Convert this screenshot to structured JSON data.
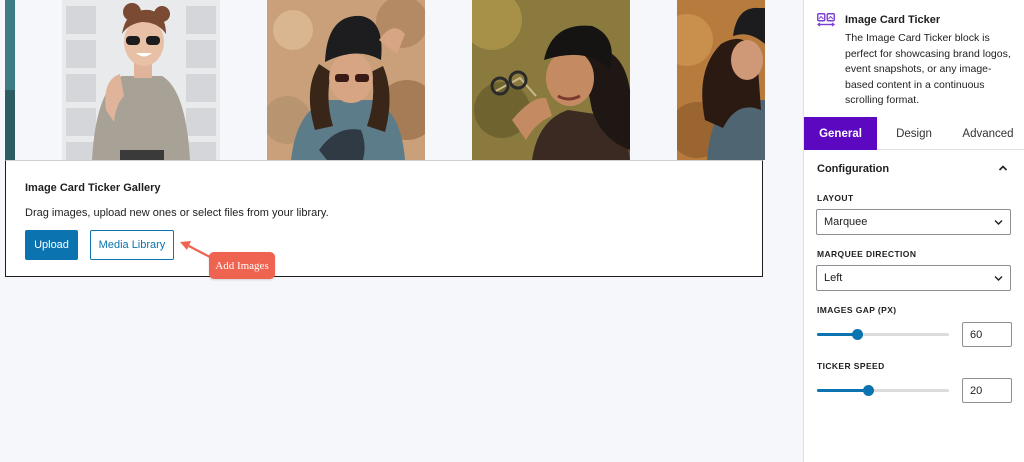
{
  "gallery": {
    "title": "Image Card Ticker Gallery",
    "instructions": "Drag images, upload new ones or select files from your library.",
    "upload_label": "Upload",
    "media_library_label": "Media Library",
    "ticker_images": [
      {
        "name": "smiling-woman-sunglasses"
      },
      {
        "name": "woman-beanie-sunglasses"
      },
      {
        "name": "woman-holding-sunglasses"
      },
      {
        "name": "woman-curly-hair-jacket"
      }
    ]
  },
  "annotation": {
    "callout_text": "Add Images"
  },
  "sidebar": {
    "block": {
      "icon": "image-card-ticker-icon",
      "title": "Image Card Ticker",
      "description": "The Image Card Ticker block is perfect for showcasing brand logos, event snapshots, or any image-based content in a continuous scrolling format."
    },
    "tabs": [
      {
        "label": "General",
        "active": true
      },
      {
        "label": "Design",
        "active": false
      },
      {
        "label": "Advanced",
        "active": false
      }
    ],
    "panel": {
      "title": "Configuration",
      "toggle_icon": "chevron-up-icon",
      "layout": {
        "label": "LAYOUT",
        "value": "Marquee"
      },
      "marquee_direction": {
        "label": "MARQUEE DIRECTION",
        "value": "Left"
      },
      "images_gap": {
        "label": "IMAGES GAP (PX)",
        "value": "60",
        "slider_fraction": 0.3
      },
      "ticker_speed": {
        "label": "TICKER SPEED",
        "value": "20",
        "slider_fraction": 0.39
      }
    }
  },
  "colors": {
    "accent_purple": "#5b08c0",
    "primary_blue": "#0a73b0",
    "callout_red": "#ef6450"
  }
}
